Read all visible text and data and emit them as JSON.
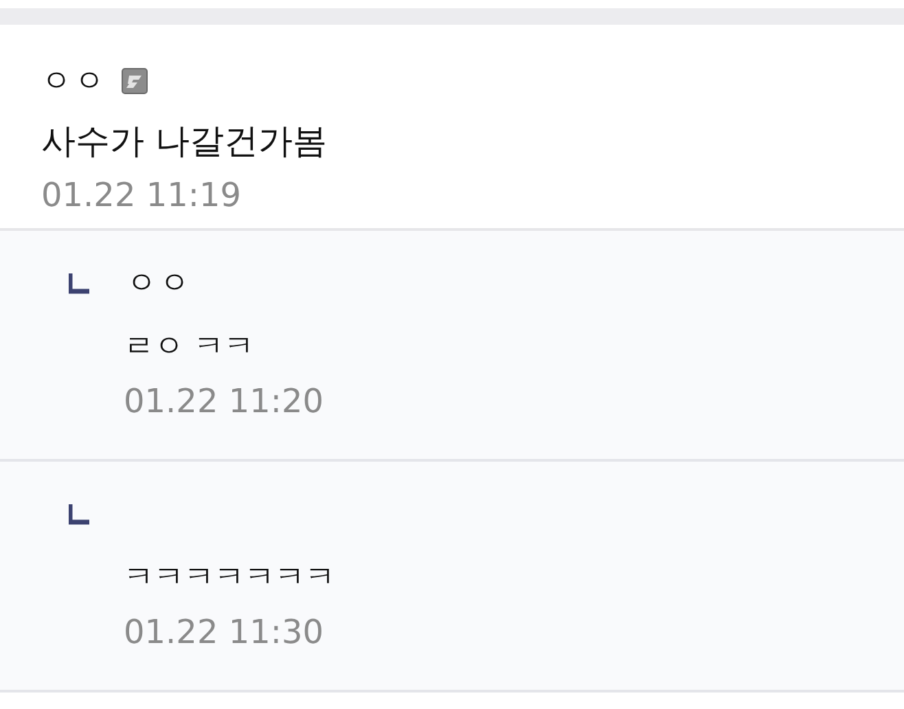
{
  "comment": {
    "author": "ㅇㅇ",
    "text": "사수가 나갈건가봄",
    "time": "01.22 11:19"
  },
  "replies": [
    {
      "author": "ㅇㅇ",
      "text": "ㄹㅇ ㅋㅋ",
      "time": "01.22 11:20"
    },
    {
      "text": "ㅋㅋㅋㅋㅋㅋㅋ",
      "time": "01.22 11:30"
    }
  ]
}
